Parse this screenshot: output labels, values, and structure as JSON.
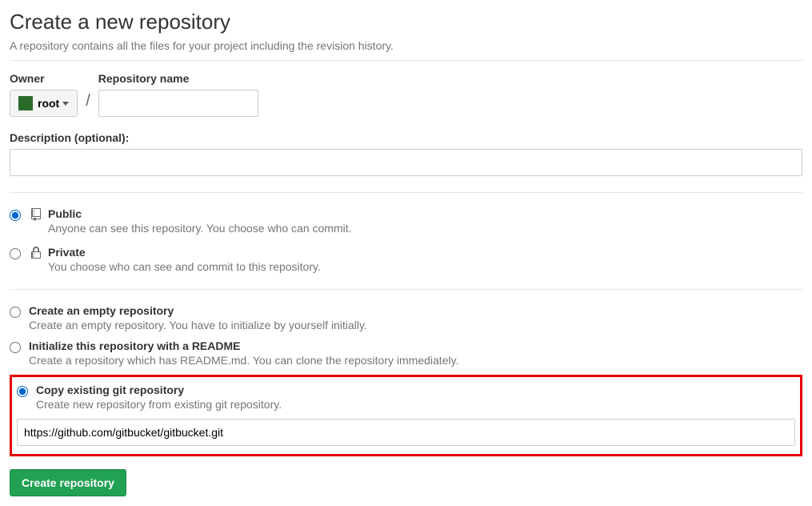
{
  "page": {
    "title": "Create a new repository",
    "subtitle": "A repository contains all the files for your project including the revision history."
  },
  "owner": {
    "label": "Owner",
    "selected": "root"
  },
  "repoName": {
    "label": "Repository name",
    "value": ""
  },
  "description": {
    "label": "Description (optional):",
    "value": ""
  },
  "visibility": {
    "public": {
      "title": "Public",
      "desc": "Anyone can see this repository. You choose who can commit."
    },
    "private": {
      "title": "Private",
      "desc": "You choose who can see and commit to this repository."
    }
  },
  "init": {
    "empty": {
      "title": "Create an empty repository",
      "desc": "Create an empty repository. You have to initialize by yourself initially."
    },
    "readme": {
      "title": "Initialize this repository with a README",
      "desc": "Create a repository which has README.md. You can clone the repository immediately."
    },
    "copy": {
      "title": "Copy existing git repository",
      "desc": "Create new repository from existing git repository.",
      "url": "https://github.com/gitbucket/gitbucket.git"
    }
  },
  "submit": {
    "label": "Create repository"
  }
}
